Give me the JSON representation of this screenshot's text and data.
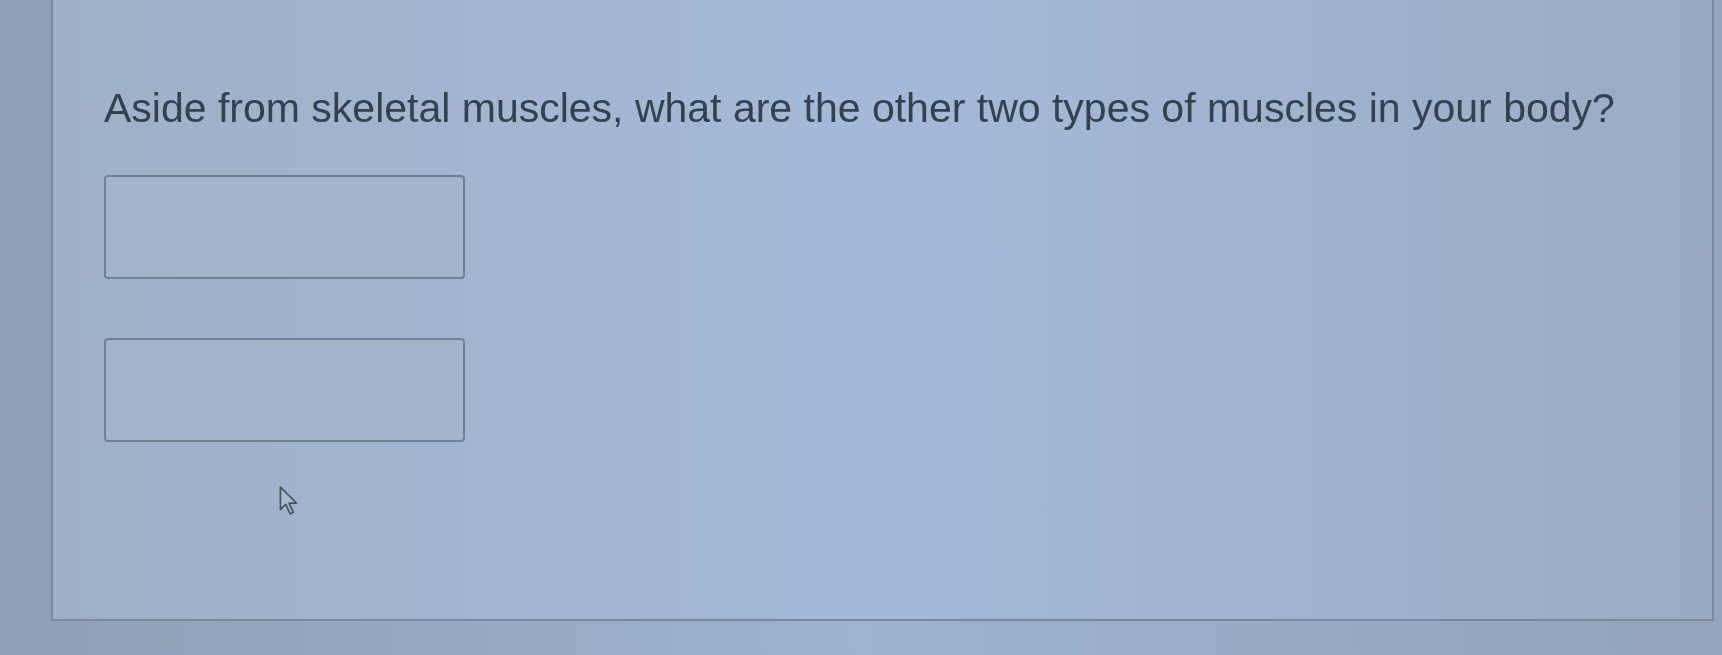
{
  "question": {
    "text": "Aside from skeletal muscles, what are the other two types of muscles in your body?"
  },
  "answers": [
    {
      "kind": "text_box"
    },
    {
      "kind": "text_box"
    }
  ]
}
